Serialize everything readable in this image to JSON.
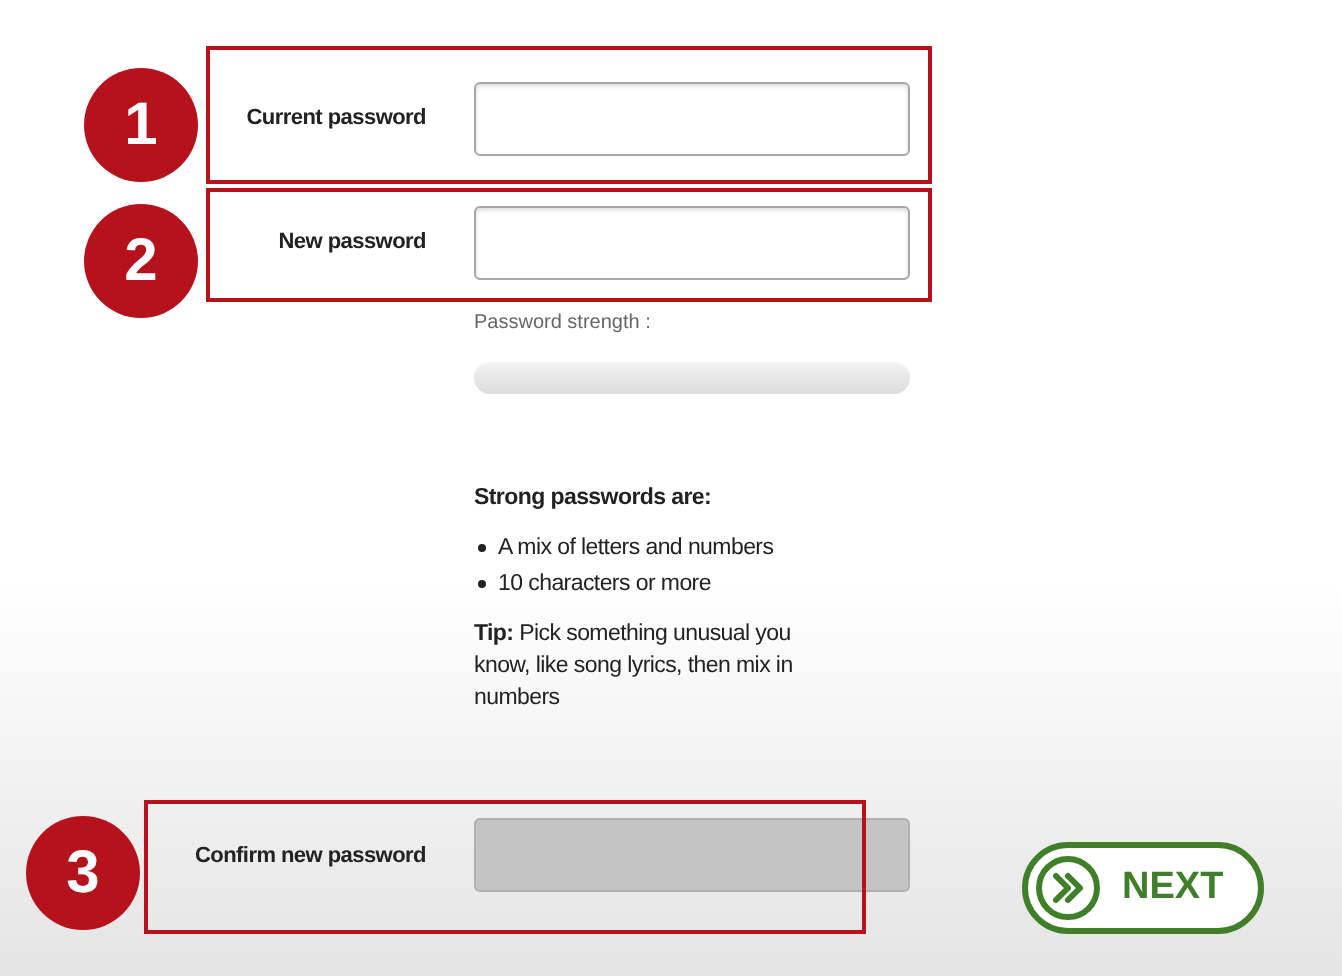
{
  "form": {
    "fields": [
      {
        "label": "Current password",
        "disabled": false
      },
      {
        "label": "New password",
        "disabled": false
      }
    ],
    "strength": {
      "label": "Password strength :"
    },
    "tips": {
      "heading": "Strong passwords are:",
      "bullets": [
        "A mix of letters and numbers",
        "10 characters or more"
      ],
      "tip": "**Tip:** Pick something unusual you know, like song lyrics, then mix in numbers"
    },
    "confirm": {
      "label": "Confirm new password",
      "disabled": true
    }
  },
  "next_button": {
    "label": "NEXT"
  },
  "annotations": [
    {
      "number": "1"
    },
    {
      "number": "2"
    },
    {
      "number": "3"
    }
  ]
}
